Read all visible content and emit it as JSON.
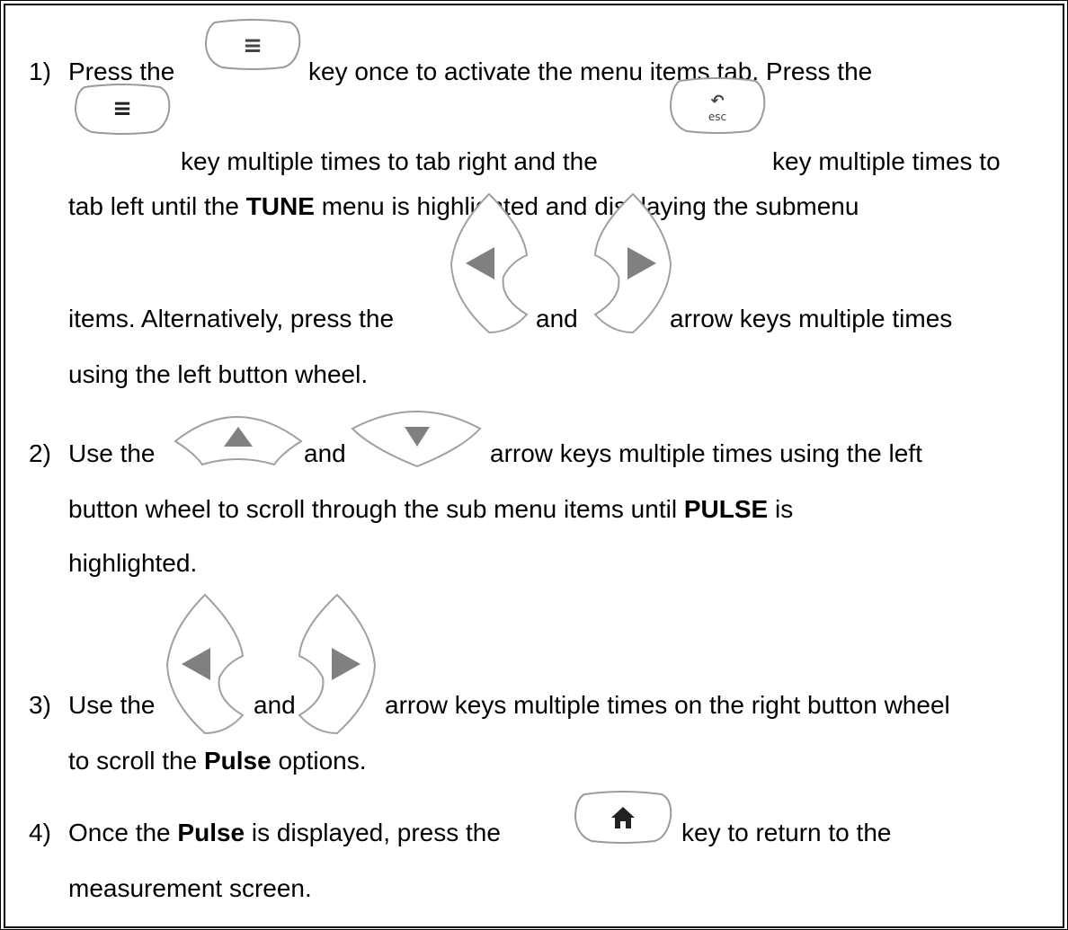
{
  "steps": [
    {
      "number": "1)",
      "segments": [
        "Press the",
        "key once to activate the menu items tab.  Press the",
        "key multiple times to tab right and the",
        "key multiple times to",
        "tab left until the",
        "TUNE",
        "menu is highlighted and displaying the submenu",
        "items.  Alternatively, press the",
        "and",
        "arrow keys multiple times",
        "using the left button wheel."
      ]
    },
    {
      "number": "2)",
      "segments": [
        "Use the",
        "and",
        "arrow keys multiple times using the left",
        "button wheel to scroll through the sub menu items until",
        "PULSE",
        "is",
        "highlighted."
      ]
    },
    {
      "number": "3)",
      "segments": [
        "Use the",
        "and",
        "arrow keys multiple times on the right button wheel",
        "to scroll the",
        "Pulse",
        "options."
      ]
    },
    {
      "number": "4)",
      "segments": [
        "Once the",
        "Pulse",
        "is displayed, press the",
        "key to return to the",
        "measurement screen."
      ]
    }
  ],
  "keys": {
    "menu_glyph": "≡",
    "esc_label": "esc",
    "esc_glyph": "↶",
    "home_glyph": "⌂"
  },
  "colors": {
    "key_fill": "#808080",
    "key_outline": "#9a9a9a",
    "text": "#000000"
  }
}
